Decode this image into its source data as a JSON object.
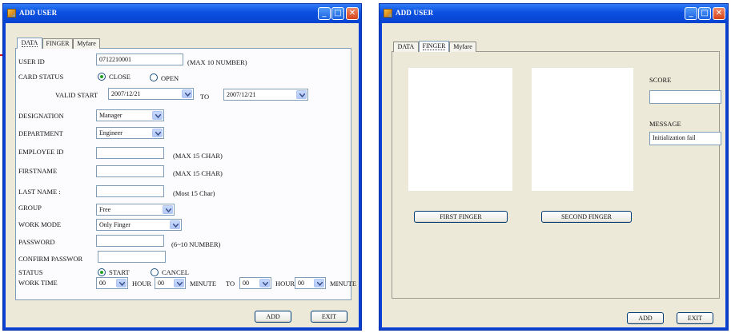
{
  "left_window": {
    "title": "ADD USER",
    "tabs": [
      "DATA",
      "FINGER",
      "Myfare"
    ],
    "user_id": {
      "label": "USER ID",
      "value": "0712210001",
      "hint": "(MAX 10 NUMBER)"
    },
    "card_status": {
      "label": "CARD STATUS",
      "close": "CLOSE",
      "open": "OPEN"
    },
    "valid": {
      "label": "VALID START",
      "start": "2007/12/21",
      "to": "TO",
      "end": "2007/12/21"
    },
    "designation": {
      "label": "DESIGNATION",
      "value": "Manager"
    },
    "department": {
      "label": "DEPARTMENT",
      "value": "Engineer"
    },
    "employee_id": {
      "label": "EMPLOYEE ID",
      "hint": "(MAX 15 CHAR)"
    },
    "firstname": {
      "label": "FIRSTNAME",
      "hint": "(MAX 15 CHAR)"
    },
    "lastname": {
      "label": "LAST NAME :",
      "hint": "(Most 15 Char)"
    },
    "group": {
      "label": "GROUP",
      "value": "Free"
    },
    "work_mode": {
      "label": "WORK MODE",
      "value": "Only Finger"
    },
    "password": {
      "label": "PASSWORD",
      "hint": "(6~10 NUMBER)"
    },
    "confirm": {
      "label": "CONFIRM PASSWOR"
    },
    "status": {
      "label": "STATUS",
      "start": "START",
      "cancel": "CANCEL"
    },
    "work_time": {
      "label": "WORK TIME",
      "h1": "00",
      "hour": "HOUR",
      "m1": "00",
      "minute": "MINUTE",
      "to": "TO",
      "h2": "00",
      "m2": "00"
    },
    "add": "ADD",
    "exit": "EXIT"
  },
  "right_window": {
    "title": "ADD USER",
    "tabs": [
      "DATA",
      "FINGER",
      "Myfare"
    ],
    "first_finger": "FIRST FINGER",
    "second_finger": "SECOND FINGER",
    "score_label": "SCORE",
    "message_label": "MESSAGE",
    "message_value": "Initialization fail",
    "add": "ADD",
    "exit": "EXIT"
  },
  "colors": {
    "titlebar": "#0a4fe0",
    "client": "#ece9d8",
    "arrow": "#d01010"
  }
}
